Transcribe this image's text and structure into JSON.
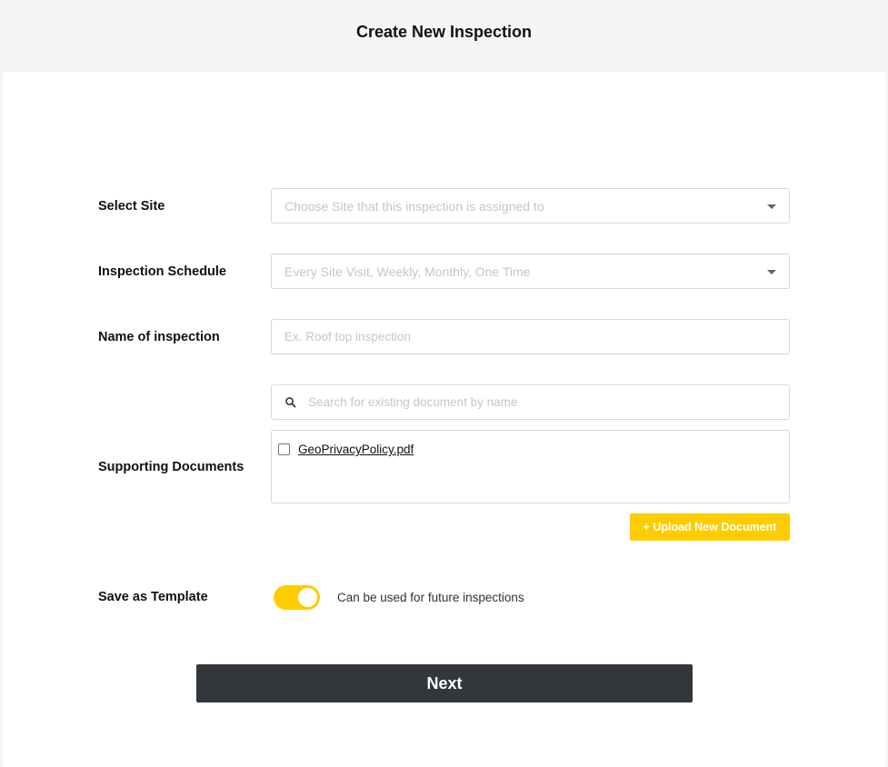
{
  "header": {
    "title": "Create New Inspection"
  },
  "form": {
    "select_site": {
      "label": "Select Site",
      "placeholder": "Choose Site that this inspection is assigned to"
    },
    "schedule": {
      "label": "Inspection Schedule",
      "placeholder": "Every Site Visit, Weekly, Monthly, One Time"
    },
    "name": {
      "label": "Name of inspection",
      "placeholder": "Ex. Roof top inspection"
    },
    "documents": {
      "label": "Supporting Documents",
      "search_placeholder": "Search for existing document by name",
      "items": [
        {
          "name": "GeoPrivacyPolicy.pdf",
          "checked": false
        }
      ],
      "upload_label": "+ Upload New Document"
    },
    "template": {
      "label": "Save as Template",
      "enabled": true,
      "caption": "Can be used for future inspections"
    },
    "next_label": "Next"
  },
  "colors": {
    "accent": "#ffcc00",
    "dark_button": "#33363b",
    "page_background": "#f4f5f7"
  },
  "icons": {
    "search": "search-icon",
    "dropdown": "chevron-down-icon"
  }
}
